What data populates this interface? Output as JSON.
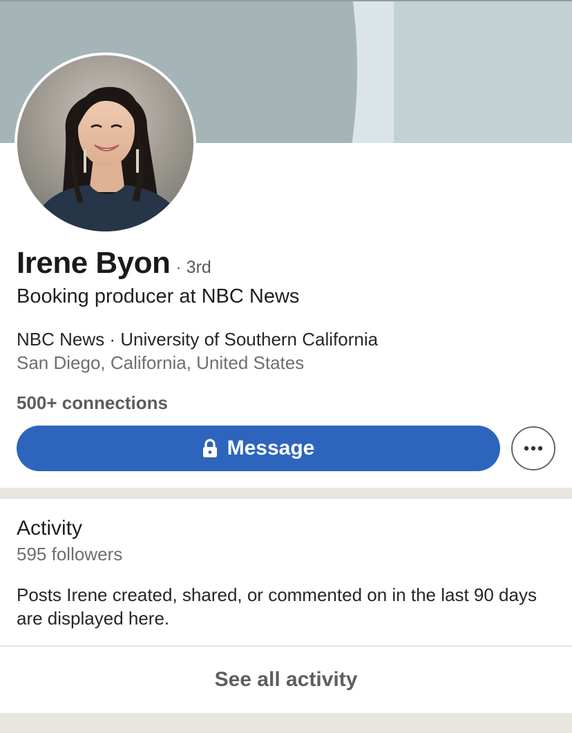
{
  "profile": {
    "name": "Irene Byon",
    "degree": "· 3rd",
    "headline": "Booking producer at NBC News",
    "company_school": "NBC News · University of Southern California",
    "location": "San Diego, California, United States",
    "connections": "500+ connections",
    "avatar_icon": "profile-photo"
  },
  "actions": {
    "message_label": "Message",
    "message_icon": "lock-icon",
    "more_icon": "more-horizontal-icon"
  },
  "activity": {
    "title": "Activity",
    "followers": "595 followers",
    "description": "Posts Irene created, shared, or commented on in the last 90 days are displayed here.",
    "see_all_label": "See all activity"
  },
  "colors": {
    "accent": "#2d65bd",
    "banner": "#a5b4b7",
    "separator": "#e9e5df"
  }
}
